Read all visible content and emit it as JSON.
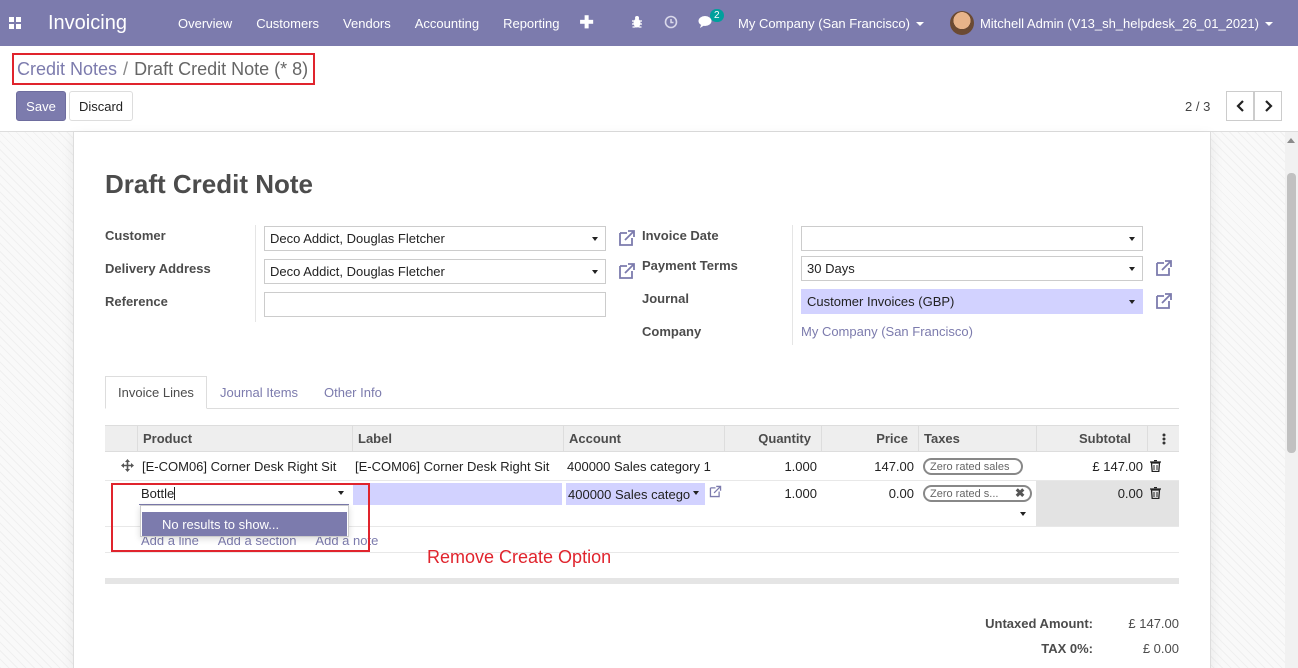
{
  "navbar": {
    "brand": "Invoicing",
    "menu": [
      "Overview",
      "Customers",
      "Vendors",
      "Accounting",
      "Reporting"
    ],
    "add_icon": "plus-icon",
    "chat_count": "2",
    "company": "My Company (San Francisco)",
    "user": "Mitchell Admin (V13_sh_helpdesk_26_01_2021)"
  },
  "breadcrumb": {
    "parent": "Credit Notes",
    "separator": "/",
    "current": "Draft Credit Note (* 8)"
  },
  "actions": {
    "save": "Save",
    "discard": "Discard"
  },
  "pager": {
    "value": "2 / 3"
  },
  "form": {
    "title": "Draft Credit Note",
    "customer_label": "Customer",
    "customer": "Deco Addict, Douglas Fletcher",
    "delivery_label": "Delivery Address",
    "delivery": "Deco Addict, Douglas Fletcher",
    "reference_label": "Reference",
    "reference": "",
    "invoice_date_label": "Invoice Date",
    "invoice_date": "",
    "payment_terms_label": "Payment Terms",
    "payment_terms": "30 Days",
    "journal_label": "Journal",
    "journal": "Customer Invoices (GBP)",
    "company_label": "Company",
    "company": "My Company (San Francisco)"
  },
  "tabs": [
    "Invoice Lines",
    "Journal Items",
    "Other Info"
  ],
  "table": {
    "headers": [
      "Product",
      "Label",
      "Account",
      "Quantity",
      "Price",
      "Taxes",
      "Subtotal"
    ],
    "row1": {
      "product": "[E-COM06] Corner Desk Right Sit",
      "label": "[E-COM06] Corner Desk Right Sit",
      "account": "400000 Sales category 1",
      "quantity": "1.000",
      "price": "147.00",
      "tax": "Zero rated sales",
      "subtotal": "£ 147.00"
    },
    "row2": {
      "product": "Bottle",
      "label": "",
      "account": "400000 Sales catego",
      "quantity": "1.000",
      "price": "0.00",
      "tax": "Zero rated s...",
      "subtotal": "0.00"
    },
    "dropdown_item": "No results to show...",
    "add_links": [
      "Add a line",
      "Add a section",
      "Add a note"
    ]
  },
  "annotation": "Remove Create Option",
  "totals": {
    "untaxed_label": "Untaxed Amount:",
    "untaxed": "£ 147.00",
    "tax_label": "TAX 0%:",
    "tax": "£ 0.00"
  },
  "colors": {
    "brand": "#7c7bad",
    "highlight": "#d2d2ff",
    "annotation": "#e0242d"
  }
}
